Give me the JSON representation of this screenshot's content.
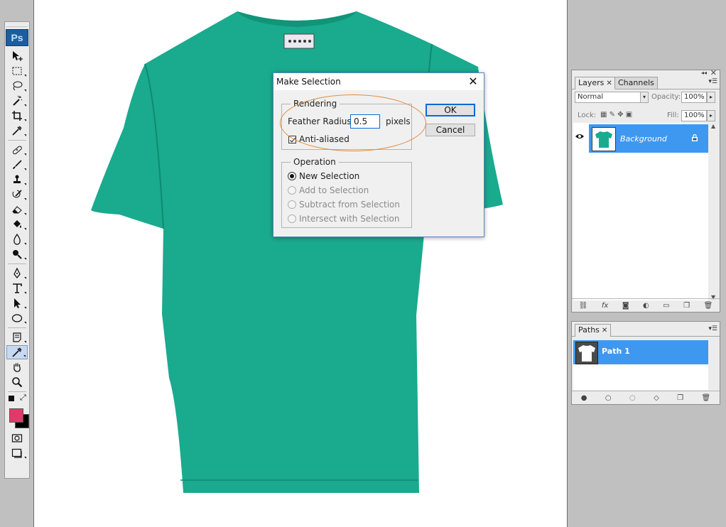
{
  "toolbox": {
    "logo": "Ps",
    "foreground_color": "#e23a68",
    "background_color": "#000000",
    "tools": [
      {
        "name": "move-tool",
        "icon": "move-icon"
      },
      {
        "name": "marquee-tool",
        "icon": "marquee-icon"
      },
      {
        "name": "lasso-tool",
        "icon": "lasso-icon"
      },
      {
        "name": "magic-wand-tool",
        "icon": "magic-wand-icon"
      },
      {
        "name": "crop-tool",
        "icon": "crop-icon"
      },
      {
        "name": "eyedropper-tool",
        "icon": "eyedropper-icon"
      },
      {
        "name": "healing-brush-tool",
        "icon": "bandage-icon"
      },
      {
        "name": "brush-tool",
        "icon": "brush-icon"
      },
      {
        "name": "clone-stamp-tool",
        "icon": "stamp-icon"
      },
      {
        "name": "history-brush-tool",
        "icon": "history-brush-icon"
      },
      {
        "name": "eraser-tool",
        "icon": "eraser-icon"
      },
      {
        "name": "paint-bucket-tool",
        "icon": "bucket-icon"
      },
      {
        "name": "blur-tool",
        "icon": "drop-icon"
      },
      {
        "name": "dodge-tool",
        "icon": "dodge-icon"
      },
      {
        "name": "pen-tool",
        "icon": "pen-icon"
      },
      {
        "name": "type-tool",
        "icon": "type-icon"
      },
      {
        "name": "path-selection-tool",
        "icon": "arrow-icon"
      },
      {
        "name": "ellipse-tool",
        "icon": "ellipse-icon"
      },
      {
        "name": "notes-tool",
        "icon": "note-icon"
      },
      {
        "name": "eyedropper-tool-2",
        "icon": "eyedropper-icon"
      },
      {
        "name": "hand-tool",
        "icon": "hand-icon"
      },
      {
        "name": "zoom-tool",
        "icon": "magnifier-icon"
      }
    ],
    "selected_tool": "eyedropper-tool-2"
  },
  "canvas": {
    "shirt_color": "#1aaa8e",
    "tag_color": "#e9e9ef"
  },
  "dialog": {
    "title": "Make Selection",
    "close_glyph": "✕",
    "rendering_legend": "Rendering",
    "feather_label": "Feather Radius:",
    "feather_value": "0.5",
    "feather_unit": "pixels",
    "anti_aliased_label": "Anti-aliased",
    "anti_aliased_checked": true,
    "operation_legend": "Operation",
    "operations": [
      "New Selection",
      "Add to Selection",
      "Subtract from Selection",
      "Intersect with Selection"
    ],
    "selected_operation": "New Selection",
    "ok_label": "OK",
    "cancel_label": "Cancel",
    "highlight_color": "#e08a3a"
  },
  "layers_panel": {
    "tabs": [
      "Layers",
      "Channels"
    ],
    "close_glyph": "✕",
    "blend_mode": "Normal",
    "opacity_label": "Opacity:",
    "opacity_value": "100%",
    "lock_label": "Lock:",
    "fill_label": "Fill:",
    "fill_value": "100%",
    "layers": [
      {
        "name": "Background",
        "locked": true,
        "visible": true
      }
    ]
  },
  "paths_panel": {
    "tabs": [
      "Paths"
    ],
    "close_glyph": "✕",
    "paths": [
      {
        "name": "Path 1"
      }
    ]
  },
  "colors": {
    "selection_blue": "#3f98ef",
    "accent_blue": "#0b69d6"
  }
}
